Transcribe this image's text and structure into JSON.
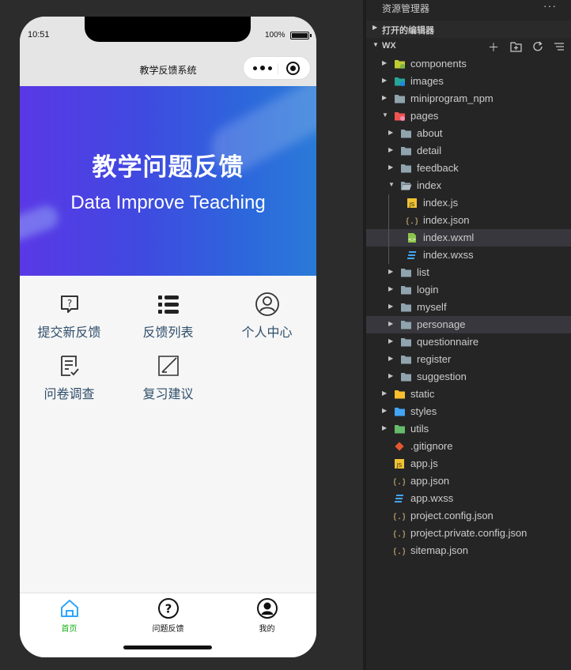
{
  "status_bar": {
    "time": "10:51",
    "battery": "100%"
  },
  "navbar": {
    "title": "教学反馈系统"
  },
  "banner": {
    "title": "教学问题反馈",
    "subtitle": "Data Improve Teaching"
  },
  "menu": [
    {
      "label": "提交新反馈",
      "icon": "feedback-icon"
    },
    {
      "label": "反馈列表",
      "icon": "list-icon"
    },
    {
      "label": "个人中心",
      "icon": "user-icon"
    },
    {
      "label": "问卷调查",
      "icon": "questionnaire-icon"
    },
    {
      "label": "复习建议",
      "icon": "edit-icon"
    }
  ],
  "tabbar": [
    {
      "label": "首页",
      "icon": "home-icon",
      "active": true
    },
    {
      "label": "问题反馈",
      "icon": "question-icon",
      "active": false
    },
    {
      "label": "我的",
      "icon": "profile-icon",
      "active": false
    }
  ],
  "explorer": {
    "title": "资源管理器",
    "open_editors": "打开的编辑器",
    "root": "WX",
    "tree": [
      {
        "name": "components",
        "kind": "folder-components"
      },
      {
        "name": "images",
        "kind": "folder-images"
      },
      {
        "name": "miniprogram_npm",
        "kind": "folder"
      },
      {
        "name": "pages",
        "kind": "folder-pages",
        "expanded": true
      },
      {
        "name": "about",
        "kind": "folder"
      },
      {
        "name": "detail",
        "kind": "folder"
      },
      {
        "name": "feedback",
        "kind": "folder"
      },
      {
        "name": "index",
        "kind": "folder-open",
        "expanded": true
      },
      {
        "name": "index.js",
        "kind": "js"
      },
      {
        "name": "index.json",
        "kind": "json"
      },
      {
        "name": "index.wxml",
        "kind": "wxml",
        "selected": true
      },
      {
        "name": "index.wxss",
        "kind": "css"
      },
      {
        "name": "list",
        "kind": "folder"
      },
      {
        "name": "login",
        "kind": "folder"
      },
      {
        "name": "myself",
        "kind": "folder"
      },
      {
        "name": "personage",
        "kind": "folder",
        "hover": true
      },
      {
        "name": "questionnaire",
        "kind": "folder"
      },
      {
        "name": "register",
        "kind": "folder"
      },
      {
        "name": "suggestion",
        "kind": "folder"
      },
      {
        "name": "static",
        "kind": "folder-static"
      },
      {
        "name": "styles",
        "kind": "folder-styles"
      },
      {
        "name": "utils",
        "kind": "folder-utils"
      },
      {
        "name": ".gitignore",
        "kind": "git"
      },
      {
        "name": "app.js",
        "kind": "js"
      },
      {
        "name": "app.json",
        "kind": "json"
      },
      {
        "name": "app.wxss",
        "kind": "css"
      },
      {
        "name": "project.config.json",
        "kind": "json"
      },
      {
        "name": "project.private.config.json",
        "kind": "json"
      },
      {
        "name": "sitemap.json",
        "kind": "json"
      }
    ]
  },
  "colors": {
    "banner_start": "#5a38e6",
    "banner_end": "#2a7ad8",
    "menu_text": "#2f4e6a",
    "tab_active": "#1aad19"
  }
}
